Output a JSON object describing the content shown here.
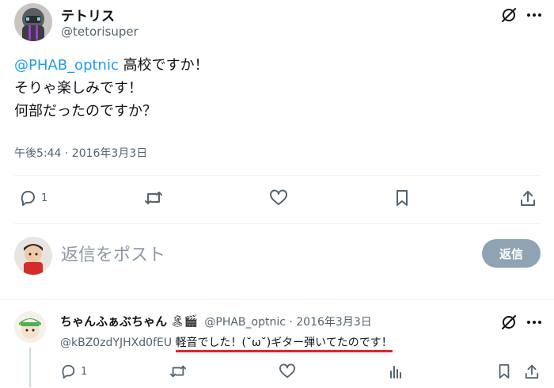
{
  "main_post": {
    "author_name": "テトリス",
    "author_handle": "@tetorisuper",
    "text_mention": "@PHAB_optnic",
    "text_line1_rest": " 高校ですか！",
    "text_line2": "そりゃ楽しみです！",
    "text_line3": "何部だったのですか？",
    "timestamp": "午後5:44 · 2016年3月3日",
    "reply_count": "1"
  },
  "reply_composer": {
    "placeholder": "返信をポスト",
    "button_label": "返信"
  },
  "reply_post": {
    "author_name": "ちゃんふぁぶちゃん",
    "emoji": "🏝🎬",
    "meta": "@PHAB_optnic · 2016年3月3日",
    "mention": "@kBZ0zdYJHXd0fEU",
    "text": "軽音でした！(˘ω˘)ギター弾いてたのです！",
    "reply_count": "1"
  },
  "icons": {
    "reply": "reply-icon",
    "retweet": "retweet-icon",
    "like": "heart-icon",
    "bookmark": "bookmark-icon",
    "share": "share-icon",
    "views": "views-icon",
    "grok": "grok-icon",
    "more": "more-icon"
  },
  "colors": {
    "link": "#1d9bf0",
    "muted": "#536471",
    "highlight_underline": "#e0252b",
    "reply_button_bg": "#8fa3b2"
  }
}
